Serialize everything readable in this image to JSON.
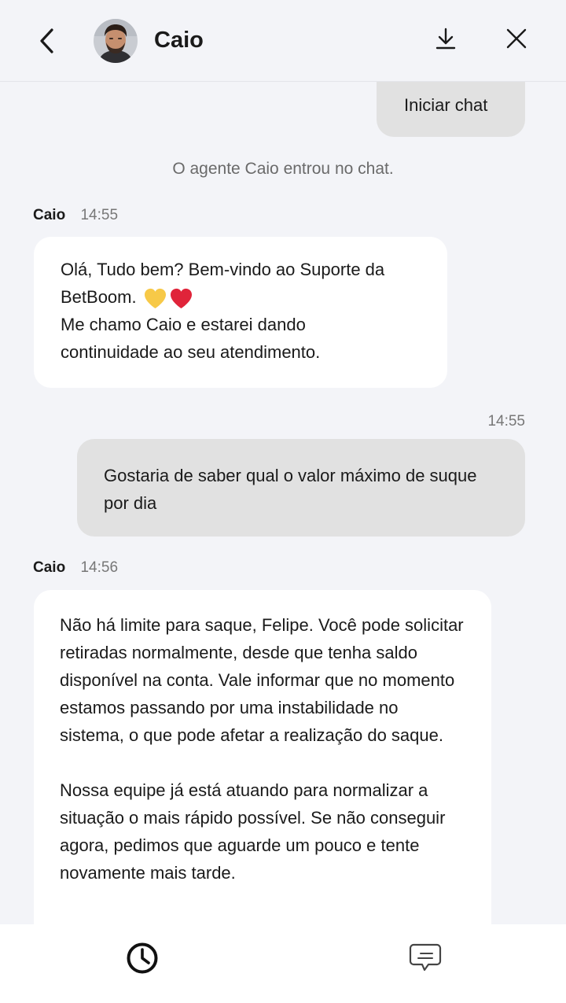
{
  "header": {
    "agent_name": "Caio",
    "back_icon": "chevron-left-icon",
    "download_icon": "download-icon",
    "close_icon": "close-icon"
  },
  "messages": {
    "outgoing_start": {
      "text": "Iniciar chat"
    },
    "system": {
      "text": "O agente Caio entrou no chat."
    },
    "agent_1": {
      "sender": "Caio",
      "time": "14:55",
      "line1": "Olá, Tudo bem? Bem-vindo ao Suporte da",
      "line2": "BetBoom.",
      "line3": "Me chamo Caio e estarei dando",
      "line4": "continuidade ao seu atendimento."
    },
    "user_1": {
      "time": "14:55",
      "text": "Gostaria de saber qual o valor máximo de suque por dia"
    },
    "agent_2": {
      "sender": "Caio",
      "time": "14:56",
      "para1": "Não há limite para saque, Felipe. Você pode solicitar retiradas normalmente, desde que tenha saldo disponível na conta. Vale informar que no momento estamos passando por uma instabilidade no sistema, o que pode afetar a realização do saque.",
      "para2": "Nossa equipe já está atuando para normalizar a situação o mais rápido possível. Se não conseguir agora, pedimos que aguarde um pouco e tente novamente mais tarde."
    }
  },
  "bottom_bar": {
    "history_icon": "clock-icon",
    "message_icon": "chat-bubble-icon"
  },
  "colors": {
    "background": "#f3f4f8",
    "outgoing_bubble": "#e1e1e1",
    "incoming_bubble": "#ffffff",
    "heart_yellow": "#f7c948",
    "heart_red": "#e0243a"
  }
}
